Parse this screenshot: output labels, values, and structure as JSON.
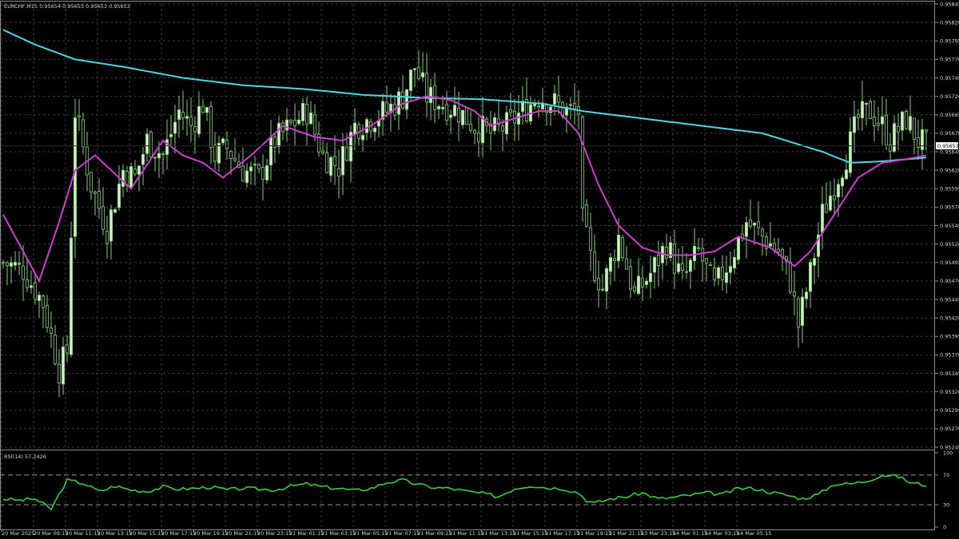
{
  "header": {
    "symbol_line": "EURCHF,M15  0.95654 0.95655 0.95653 0.95653",
    "rsi_line": "RSI(14) 57.2426"
  },
  "colors": {
    "background": "#000000",
    "grid": "#3a3a3a",
    "bull": "#cfeec4",
    "bear": "#000000",
    "wick": "#7fcf6f",
    "ma_slow": "#4fd6e0",
    "ma_fast": "#d23cd2",
    "rsi": "#3fcb3f"
  },
  "chart_data": [
    {
      "type": "candlestick",
      "title": "EURCHF,M15",
      "y_range": [
        0.95245,
        0.95845
      ],
      "y_ticks": [
        "0.95845",
        "0.95820",
        "0.95795",
        "0.95770",
        "0.95745",
        "0.95720",
        "0.95695",
        "0.95670",
        "0.95645",
        "0.95620",
        "0.95595",
        "0.95570",
        "0.95545",
        "0.95520",
        "0.95495",
        "0.95470",
        "0.95445",
        "0.95420",
        "0.95395",
        "0.95370",
        "0.95345",
        "0.95320",
        "0.95295",
        "0.95270",
        "0.95245"
      ],
      "current_price_label": "0.95653",
      "current_price": 0.95653,
      "x_tick_labels": [
        "20 Mar 2025",
        "20 Mar 09:15",
        "20 Mar 11:15",
        "20 Mar 13:15",
        "20 Mar 15:15",
        "20 Mar 17:15",
        "20 Mar 19:15",
        "20 Mar 21:15",
        "20 Mar 23:15",
        "21 Mar 01:15",
        "21 Mar 03:15",
        "21 Mar 05:15",
        "21 Mar 07:15",
        "21 Mar 09:15",
        "21 Mar 11:15",
        "21 Mar 13:15",
        "21 Mar 15:15",
        "21 Mar 17:15",
        "21 Mar 19:15",
        "21 Mar 21:15",
        "23 Mar 23:15",
        "24 Mar 01:15",
        "24 Mar 03:15",
        "24 Mar 05:15"
      ],
      "anchor_closes": [
        [
          0,
          0.95495
        ],
        [
          5,
          0.95485
        ],
        [
          10,
          0.9544
        ],
        [
          14,
          0.9535
        ],
        [
          16,
          0.95375
        ],
        [
          18,
          0.957
        ],
        [
          22,
          0.956
        ],
        [
          26,
          0.9554
        ],
        [
          30,
          0.9562
        ],
        [
          33,
          0.9561
        ],
        [
          36,
          0.9566
        ],
        [
          40,
          0.9564
        ],
        [
          44,
          0.957
        ],
        [
          47,
          0.9568
        ],
        [
          50,
          0.9571
        ],
        [
          53,
          0.9564
        ],
        [
          56,
          0.9565
        ],
        [
          60,
          0.9562
        ],
        [
          64,
          0.9561
        ],
        [
          68,
          0.9566
        ],
        [
          72,
          0.9568
        ],
        [
          76,
          0.957
        ],
        [
          80,
          0.9564
        ],
        [
          84,
          0.95625
        ],
        [
          88,
          0.9568
        ],
        [
          92,
          0.9569
        ],
        [
          96,
          0.957
        ],
        [
          100,
          0.9572
        ],
        [
          103,
          0.9576
        ],
        [
          106,
          0.9572
        ],
        [
          110,
          0.9571
        ],
        [
          114,
          0.957
        ],
        [
          118,
          0.9568
        ],
        [
          122,
          0.9567
        ],
        [
          126,
          0.9568
        ],
        [
          130,
          0.957
        ],
        [
          134,
          0.9572
        ],
        [
          138,
          0.9571
        ],
        [
          141,
          0.957
        ],
        [
          144,
          0.957
        ],
        [
          145,
          0.9555
        ],
        [
          147,
          0.955
        ],
        [
          150,
          0.9546
        ],
        [
          154,
          0.9553
        ],
        [
          158,
          0.9545
        ],
        [
          162,
          0.9548
        ],
        [
          166,
          0.9552
        ],
        [
          170,
          0.9547
        ],
        [
          174,
          0.9551
        ],
        [
          178,
          0.9546
        ],
        [
          182,
          0.955
        ],
        [
          186,
          0.9555
        ],
        [
          190,
          0.9553
        ],
        [
          194,
          0.9551
        ],
        [
          197,
          0.9547
        ],
        [
          199,
          0.9541
        ],
        [
          202,
          0.9548
        ],
        [
          205,
          0.9556
        ],
        [
          208,
          0.956
        ],
        [
          211,
          0.9564
        ],
        [
          214,
          0.9569
        ],
        [
          217,
          0.957
        ],
        [
          220,
          0.9568
        ],
        [
          222,
          0.9566
        ],
        [
          226,
          0.9569
        ],
        [
          229,
          0.9566
        ],
        [
          231,
          0.95653
        ]
      ],
      "ma_fast": [
        [
          0,
          0.9556
        ],
        [
          9,
          0.9547
        ],
        [
          14,
          0.9555
        ],
        [
          18,
          0.9562
        ],
        [
          23,
          0.9564
        ],
        [
          32,
          0.95595
        ],
        [
          40,
          0.9566
        ],
        [
          45,
          0.9564
        ],
        [
          50,
          0.9563
        ],
        [
          55,
          0.9561
        ],
        [
          62,
          0.9564
        ],
        [
          70,
          0.9568
        ],
        [
          78,
          0.95665
        ],
        [
          85,
          0.9566
        ],
        [
          92,
          0.9568
        ],
        [
          100,
          0.9571
        ],
        [
          106,
          0.9572
        ],
        [
          112,
          0.95715
        ],
        [
          118,
          0.957
        ],
        [
          122,
          0.9568
        ],
        [
          128,
          0.9569
        ],
        [
          134,
          0.957
        ],
        [
          139,
          0.957
        ],
        [
          144,
          0.9567
        ],
        [
          149,
          0.956
        ],
        [
          154,
          0.95545
        ],
        [
          160,
          0.95515
        ],
        [
          166,
          0.95505
        ],
        [
          172,
          0.95505
        ],
        [
          178,
          0.9551
        ],
        [
          184,
          0.9553
        ],
        [
          192,
          0.95515
        ],
        [
          198,
          0.9549
        ],
        [
          202,
          0.9551
        ],
        [
          208,
          0.9556
        ],
        [
          214,
          0.9561
        ],
        [
          220,
          0.9563
        ],
        [
          226,
          0.95635
        ],
        [
          231,
          0.9564
        ]
      ],
      "ma_slow": [
        [
          0,
          0.9581
        ],
        [
          8,
          0.9579
        ],
        [
          18,
          0.9577
        ],
        [
          30,
          0.9576
        ],
        [
          45,
          0.95745
        ],
        [
          60,
          0.95735
        ],
        [
          75,
          0.9573
        ],
        [
          90,
          0.95722
        ],
        [
          105,
          0.95718
        ],
        [
          120,
          0.95716
        ],
        [
          135,
          0.9571
        ],
        [
          145,
          0.957
        ],
        [
          160,
          0.9569
        ],
        [
          175,
          0.9568
        ],
        [
          190,
          0.9567
        ],
        [
          205,
          0.95645
        ],
        [
          212,
          0.9563
        ],
        [
          220,
          0.95632
        ],
        [
          231,
          0.95637
        ]
      ]
    },
    {
      "type": "line",
      "title": "RSI(14) 57.2426",
      "y_range": [
        0,
        100
      ],
      "y_ticks": [
        "100",
        "70",
        "30",
        "0"
      ],
      "levels": [
        70,
        30
      ],
      "rsi": [
        [
          0,
          38
        ],
        [
          4,
          36
        ],
        [
          8,
          38
        ],
        [
          12,
          24
        ],
        [
          14,
          44
        ],
        [
          16,
          63
        ],
        [
          20,
          59
        ],
        [
          24,
          48
        ],
        [
          28,
          55
        ],
        [
          32,
          50
        ],
        [
          36,
          48
        ],
        [
          40,
          54
        ],
        [
          44,
          51
        ],
        [
          48,
          52
        ],
        [
          52,
          54
        ],
        [
          56,
          50
        ],
        [
          60,
          52
        ],
        [
          64,
          51
        ],
        [
          68,
          50
        ],
        [
          72,
          55
        ],
        [
          76,
          58
        ],
        [
          80,
          54
        ],
        [
          84,
          52
        ],
        [
          88,
          49
        ],
        [
          92,
          52
        ],
        [
          96,
          60
        ],
        [
          100,
          63
        ],
        [
          104,
          57
        ],
        [
          108,
          53
        ],
        [
          112,
          52
        ],
        [
          116,
          48
        ],
        [
          120,
          45
        ],
        [
          124,
          41
        ],
        [
          128,
          52
        ],
        [
          132,
          56
        ],
        [
          136,
          53
        ],
        [
          140,
          52
        ],
        [
          144,
          46
        ],
        [
          146,
          36
        ],
        [
          148,
          32
        ],
        [
          152,
          38
        ],
        [
          156,
          41
        ],
        [
          160,
          46
        ],
        [
          164,
          38
        ],
        [
          168,
          40
        ],
        [
          172,
          43
        ],
        [
          176,
          46
        ],
        [
          180,
          44
        ],
        [
          184,
          52
        ],
        [
          188,
          52
        ],
        [
          192,
          47
        ],
        [
          196,
          43
        ],
        [
          200,
          38
        ],
        [
          204,
          44
        ],
        [
          208,
          58
        ],
        [
          212,
          58
        ],
        [
          216,
          62
        ],
        [
          220,
          70
        ],
        [
          224,
          68
        ],
        [
          227,
          60
        ],
        [
          230,
          57
        ],
        [
          231,
          57
        ]
      ]
    }
  ]
}
